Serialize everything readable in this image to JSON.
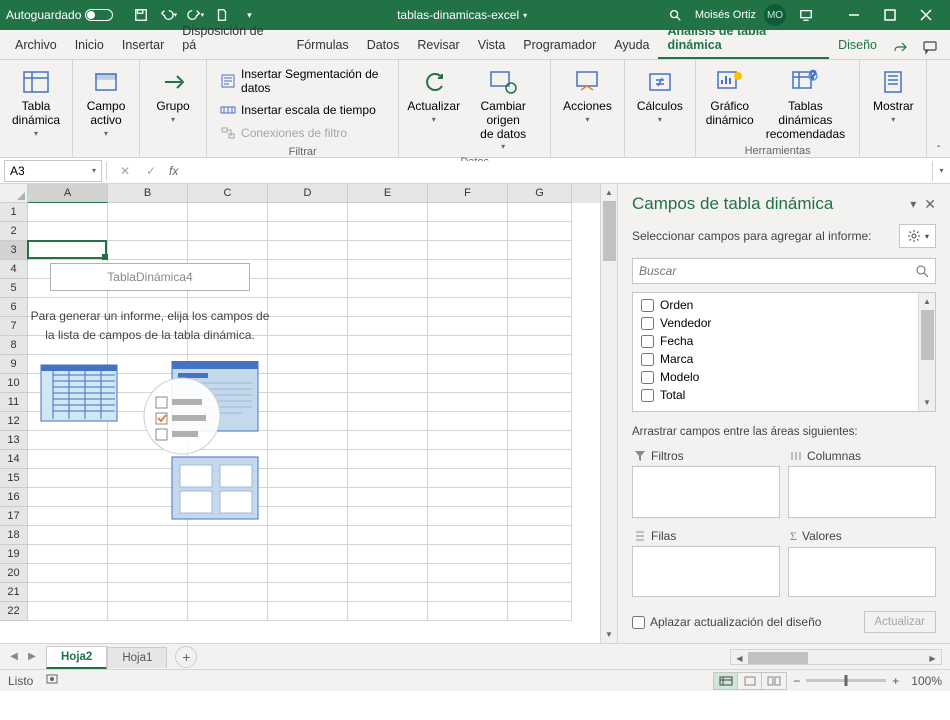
{
  "titlebar": {
    "autosave": "Autoguardado",
    "filename": "tablas-dinamicas-excel",
    "user": "Moisés Ortiz",
    "initials": "MO"
  },
  "tabs": {
    "archivo": "Archivo",
    "inicio": "Inicio",
    "insertar": "Insertar",
    "disposicion": "Disposición de pá",
    "formulas": "Fórmulas",
    "datos": "Datos",
    "revisar": "Revisar",
    "vista": "Vista",
    "programador": "Programador",
    "ayuda": "Ayuda",
    "analisis": "Análisis de tabla dinámica",
    "diseno": "Diseño"
  },
  "ribbon": {
    "tabladin": "Tabla\ndinámica",
    "campo": "Campo\nactivo",
    "grupo": "Grupo",
    "seg": "Insertar Segmentación de datos",
    "escala": "Insertar escala de tiempo",
    "conex": "Conexiones de filtro",
    "filtrar": "Filtrar",
    "actualizar": "Actualizar",
    "cambiar": "Cambiar origen\nde datos",
    "datos": "Datos",
    "acciones": "Acciones",
    "calculos": "Cálculos",
    "grafico": "Gráfico\ndinámico",
    "recom": "Tablas dinámicas\nrecomendadas",
    "herramientas": "Herramientas",
    "mostrar": "Mostrar"
  },
  "namebox": "A3",
  "cols": [
    "A",
    "B",
    "C",
    "D",
    "E",
    "F",
    "G"
  ],
  "placeholder": {
    "title": "TablaDinámica4",
    "text": "Para generar un informe, elija los campos de la lista de campos de la tabla dinámica."
  },
  "pane": {
    "title": "Campos de tabla dinámica",
    "subtitle": "Seleccionar campos para agregar al informe:",
    "search": "Buscar",
    "fields": [
      "Orden",
      "Vendedor",
      "Fecha",
      "Marca",
      "Modelo",
      "Total"
    ],
    "areas_lbl": "Arrastrar campos entre las áreas siguientes:",
    "filtros": "Filtros",
    "columnas": "Columnas",
    "filas": "Filas",
    "valores": "Valores",
    "defer": "Aplazar actualización del diseño",
    "update": "Actualizar"
  },
  "sheets": {
    "s1": "Hoja2",
    "s2": "Hoja1"
  },
  "status": {
    "ready": "Listo",
    "zoom": "100%"
  }
}
